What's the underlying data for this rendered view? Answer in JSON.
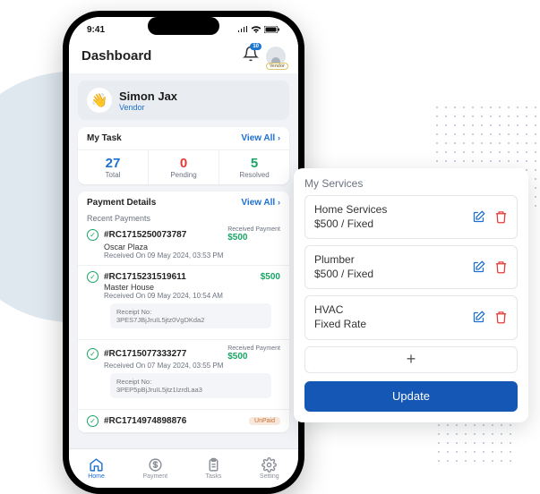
{
  "status": {
    "time": "9:41"
  },
  "header": {
    "title": "Dashboard",
    "notif_count": "10",
    "avatar_label": "Vendor"
  },
  "profile": {
    "wave": "👋",
    "name": "Simon Jax",
    "role": "Vendor"
  },
  "my_task": {
    "title": "My Task",
    "view_all": "View All",
    "stats": [
      {
        "value": "27",
        "label": "Total"
      },
      {
        "value": "0",
        "label": "Pending"
      },
      {
        "value": "5",
        "label": "Resolved"
      }
    ]
  },
  "payment": {
    "title": "Payment Details",
    "view_all": "View All",
    "recent": "Recent Payments",
    "items": [
      {
        "id": "#RC1715250073787",
        "vendor": "Oscar Plaza",
        "received": "Received On 09 May 2024, 03:53 PM",
        "amount_label": "Received Payment",
        "amount": "$500"
      },
      {
        "id": "#RC1715231519611",
        "vendor": "Master House",
        "received": "Received On 09 May 2024, 10:54 AM",
        "amount": "$500",
        "receipt_label": "Receipt No:",
        "receipt": "3PES7JBjJruIL5jtz0VgDKda2"
      },
      {
        "id": "#RC1715077333277",
        "received": "Received On 07 May 2024, 03:55 PM",
        "amount_label": "Received Payment",
        "amount": "$500",
        "receipt_label": "Receipt No:",
        "receipt": "3PEP5pBjJruIL5jtz1IzrdLaa3"
      },
      {
        "id": "#RC1714974898876",
        "status": "UnPaid"
      }
    ]
  },
  "tabs": [
    {
      "label": "Home"
    },
    {
      "label": "Payment"
    },
    {
      "label": "Tasks"
    },
    {
      "label": "Setting"
    }
  ],
  "overlay": {
    "title": "My Services",
    "services": [
      {
        "name": "Home Services",
        "price": "$500 / Fixed"
      },
      {
        "name": "Plumber",
        "price": "$500 / Fixed"
      },
      {
        "name": "HVAC",
        "price": "Fixed Rate"
      }
    ],
    "update": "Update"
  }
}
